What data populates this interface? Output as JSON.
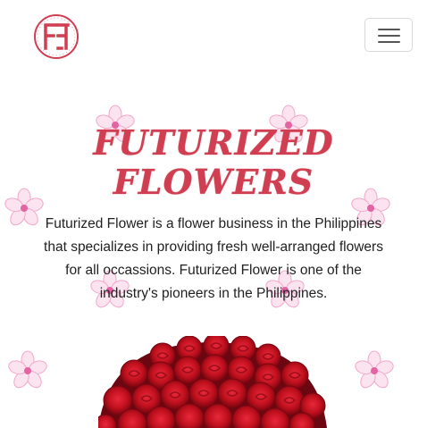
{
  "navbar": {
    "logo_text": "FF",
    "menu_button_icon": "hamburger-menu-icon"
  },
  "hero": {
    "title_line1": "FUTURIZED",
    "title_line2": "FLOWERS",
    "description": "Futurized Flower is a flower business in the Philippines that specializes in providing fresh well-arranged flowers for all occassions. Futurized Flower is one of the industry's pioneers in the Philippines.",
    "decor_icon": "cherry-blossom-icon",
    "image_subject": "red-roses-bouquet"
  },
  "colors": {
    "brand": "#d03e51",
    "blossom": "#f4b8d8",
    "rose": "#c0101e"
  }
}
